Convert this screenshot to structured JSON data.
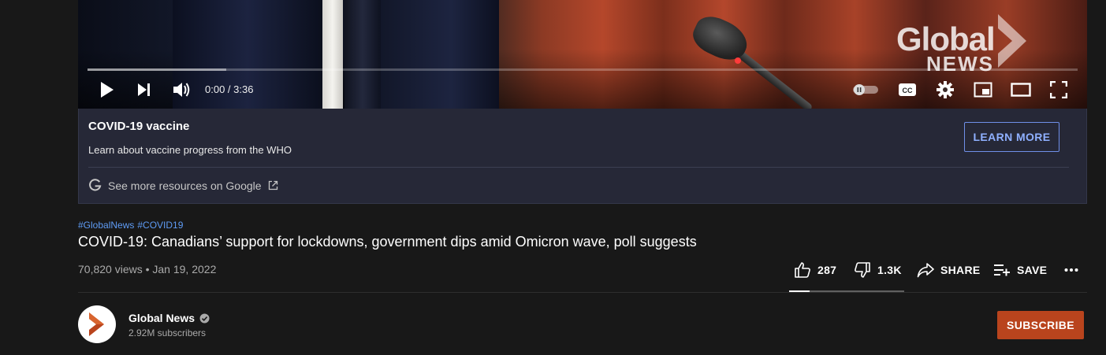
{
  "player": {
    "time_display": "0:00 / 3:36",
    "progress_fraction": 0,
    "buffered_fraction": 0.14,
    "watermark": {
      "line1": "Global",
      "line2": "NEWS"
    },
    "controls": [
      "play-icon",
      "next-icon",
      "volume-icon",
      "autoplay-toggle-icon",
      "captions-icon",
      "settings-icon",
      "miniplayer-icon",
      "theater-mode-icon",
      "fullscreen-icon"
    ],
    "captions_label": "CC"
  },
  "info_panel": {
    "title": "COVID-19 vaccine",
    "description": "Learn about vaccine progress from the WHO",
    "learn_more_label": "LEARN MORE",
    "google_link_label": "See more resources on Google"
  },
  "video": {
    "hashtags": [
      "#GlobalNews",
      "#COVID19"
    ],
    "title": "COVID-19: Canadians’ support for lockdowns, government dips amid Omicron wave, poll suggests",
    "views_and_date": "70,820 views • Jan 19, 2022"
  },
  "actions": {
    "likes": "287",
    "dislikes": "1.3K",
    "share_label": "SHARE",
    "save_label": "SAVE",
    "like_ratio": 0.18
  },
  "channel": {
    "name": "Global News",
    "subscribers": "2.92M subscribers",
    "subscribe_label": "SUBSCRIBE"
  },
  "colors": {
    "background": "#181818",
    "info_panel": "#262837",
    "learn_more": "#8fb0ff",
    "hashtag": "#5f9cf5",
    "subscribe": "#b9441d",
    "progress": "#ff0000"
  }
}
